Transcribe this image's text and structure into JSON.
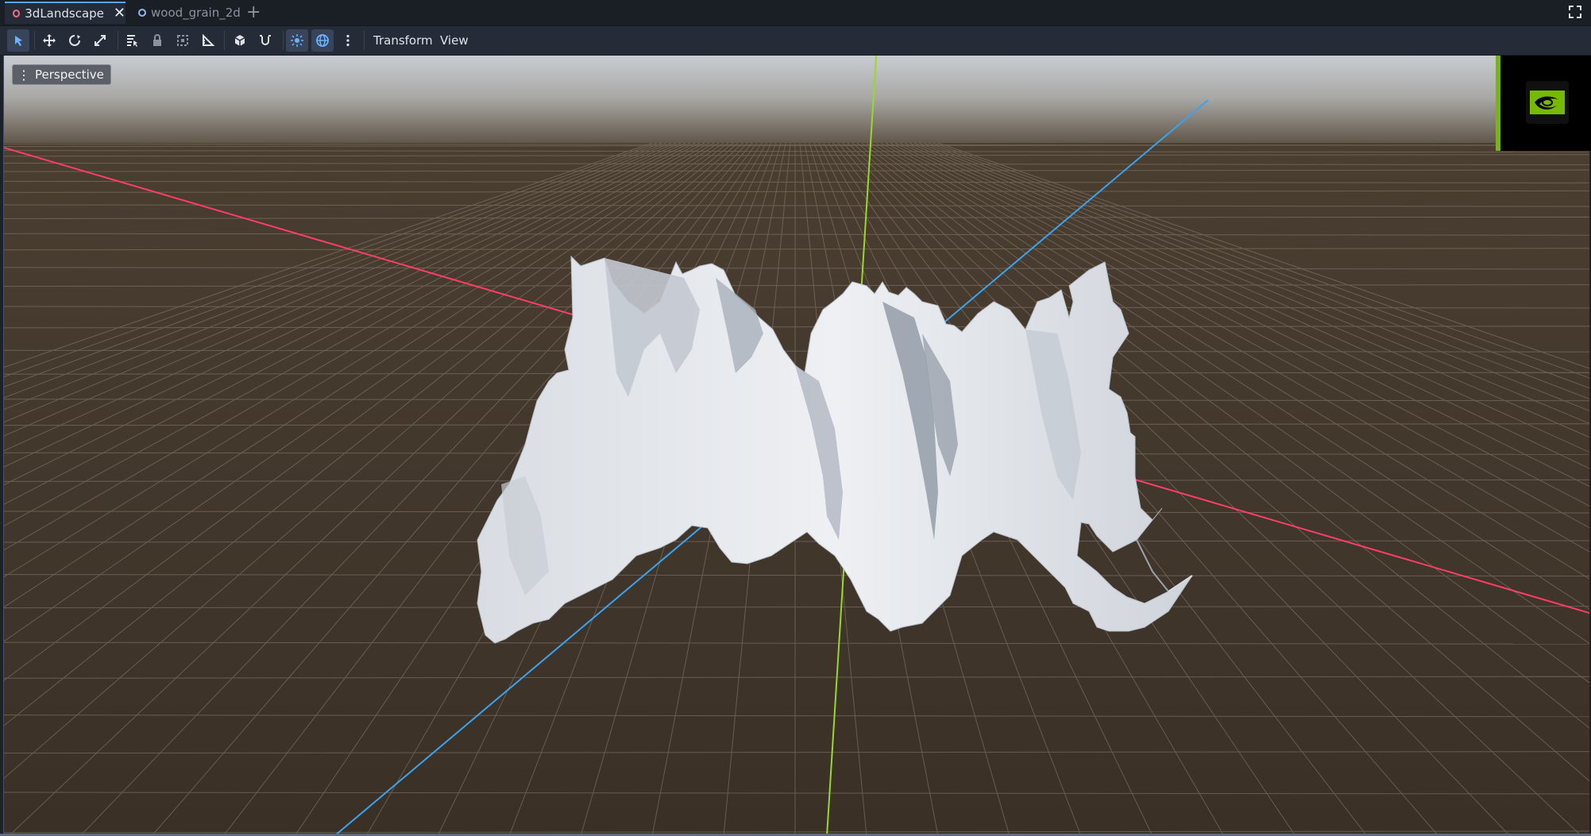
{
  "tabs": [
    {
      "label": "3dLandscape",
      "active": true
    },
    {
      "label": "wood_grain_2d",
      "active": false
    }
  ],
  "tab_add_label": "+",
  "tab_close_label": "✕",
  "toolbar": {
    "icons": [
      "select-tool-icon",
      "move-tool-icon",
      "rotate-tool-icon",
      "scale-tool-icon",
      "list-select-icon",
      "lock-icon",
      "group-icon",
      "ruler-icon",
      "local-space-icon",
      "snap-icon",
      "sun-preview-icon",
      "environment-preview-icon",
      "more-options-icon"
    ],
    "menus": [
      "Transform",
      "View"
    ]
  },
  "viewport": {
    "view_mode_label": "Perspective",
    "dots": "⋮"
  },
  "colors": {
    "accent": "#57a5f0",
    "x_axis": "#ff3d66",
    "y_axis": "#9bd72a",
    "z_axis": "#3aa3f2",
    "ground": "#3b3127",
    "nvidia_green": "#76b900"
  }
}
